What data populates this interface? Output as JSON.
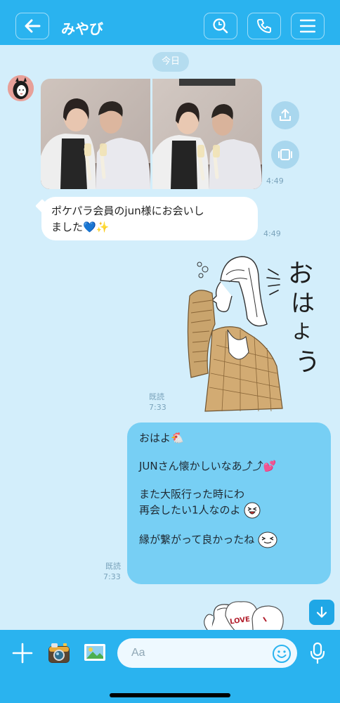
{
  "header": {
    "title": "みやび",
    "back_icon": "arrow-left-icon",
    "actions": [
      "search-icon",
      "phone-icon",
      "menu-icon"
    ],
    "bg_color": "#2ab3ef"
  },
  "chat": {
    "bg_color": "#d3eefb",
    "date_label": "今日",
    "images_time": "4:49",
    "message_in": {
      "line1": "ポケパラ会員のjun様にお会いし",
      "line2": "ました💙✨",
      "time": "4:49"
    },
    "sticker_text": "おはよう",
    "sticker_read": "既読",
    "sticker_time": "7:33",
    "message_out": {
      "line1": "おはよ🐔",
      "line2": "JUNさん懐かしいなあ⤴︎⤴︎💕",
      "line3": "また大阪行った時にわ",
      "line4": "再会したい1人なのよ",
      "line5": "縁が繋がって良かったね",
      "read": "既読",
      "time": "7:33",
      "bg_color": "#77cff4"
    },
    "sticker2_text": "LOVE"
  },
  "composer": {
    "placeholder": "Aa",
    "icons": [
      "plus-icon",
      "camera-icon",
      "image-icon",
      "emoji-icon",
      "mic-icon"
    ]
  }
}
